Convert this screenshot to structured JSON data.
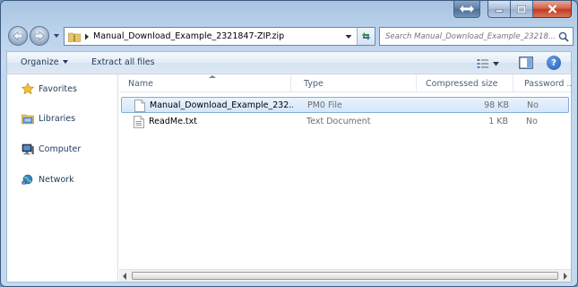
{
  "window": {
    "buttons": {
      "resize": "resize-arrows-icon",
      "minimize": "minimize-icon",
      "maximize": "maximize-icon",
      "close": "close-icon"
    }
  },
  "address_bar": {
    "path_segment": "Manual_Download_Example_2321847-ZIP.zip"
  },
  "search": {
    "placeholder": "Search Manual_Download_Example_23218..."
  },
  "toolbar": {
    "organize_label": "Organize",
    "extract_label": "Extract all files"
  },
  "navigation": {
    "items": [
      {
        "label": "Favorites",
        "icon": "star-icon"
      },
      {
        "label": "Libraries",
        "icon": "libraries-icon"
      },
      {
        "label": "Computer",
        "icon": "computer-icon"
      },
      {
        "label": "Network",
        "icon": "network-icon"
      }
    ]
  },
  "file_list": {
    "columns": [
      "Name",
      "Type",
      "Compressed size",
      "Password ..."
    ],
    "rows": [
      {
        "name": "Manual_Download_Example_232...",
        "type": "PM0 File",
        "size": "98 KB",
        "password": "No",
        "selected": true
      },
      {
        "name": "ReadMe.txt",
        "type": "Text Document",
        "size": "1 KB",
        "password": "No",
        "selected": false
      }
    ]
  },
  "colors": {
    "accent": "#1e395b",
    "selection": "#d3e6fa",
    "close": "#c23c23"
  }
}
